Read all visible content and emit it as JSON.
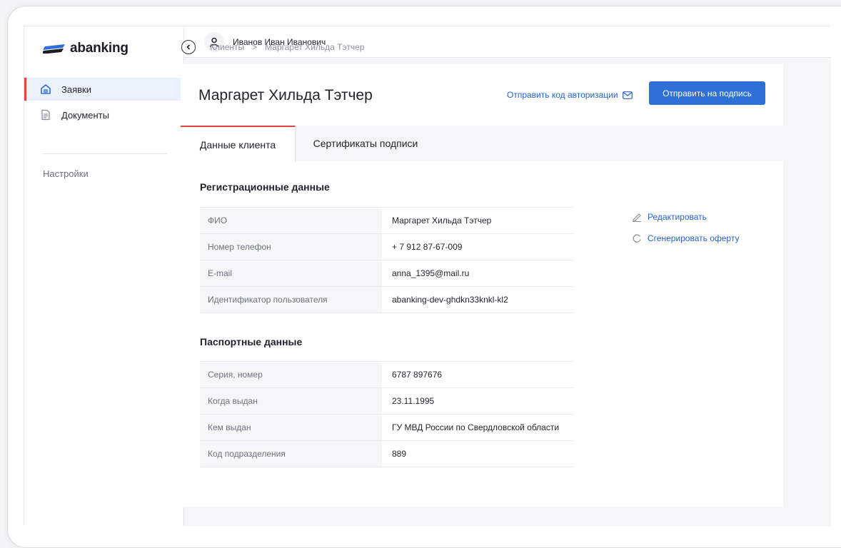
{
  "brand": {
    "name": "abanking",
    "color": "#2f6fd8",
    "accent": "#e0443a"
  },
  "sidebar": {
    "items": [
      {
        "label": "Заявки",
        "icon": "home-icon",
        "active": true
      },
      {
        "label": "Документы",
        "icon": "document-icon",
        "active": false
      }
    ],
    "settings_label": "Настройки"
  },
  "topbar": {
    "user_name": "Иванов Иван Иванович",
    "icon": "user-icon"
  },
  "breadcrumb": {
    "items": [
      "Клиенты",
      "Маргарет Хильда Тэтчер"
    ],
    "separator": ">"
  },
  "page": {
    "title": "Маргарет Хильда Тэтчер",
    "send_code_label": "Отправить код авторизации",
    "send_sign_label": "Отправить на подпись"
  },
  "tabs": [
    {
      "label": "Данные клиента",
      "active": true
    },
    {
      "label": "Сертификаты подписи",
      "active": false
    }
  ],
  "registration": {
    "title": "Регистрационные данные",
    "rows": [
      {
        "key": "ФИО",
        "value": "Маргарет Хильда Тэтчер"
      },
      {
        "key": "Номер телефон",
        "value": "+ 7 912 87-67-009"
      },
      {
        "key": "E-mail",
        "value": "anna_1395@mail.ru"
      },
      {
        "key": "Идентификатор пользователя",
        "value": "abanking-dev-ghdkn33knkl-kl2"
      }
    ]
  },
  "passport": {
    "title": "Паспортные данные",
    "rows": [
      {
        "key": "Серия, номер",
        "value": "6787 897676"
      },
      {
        "key": "Когда выдан",
        "value": "23.11.1995"
      },
      {
        "key": "Кем выдан",
        "value": "ГУ МВД России по Свердловской области"
      },
      {
        "key": "Код подразделения",
        "value": "889"
      }
    ]
  },
  "actions": {
    "edit_label": "Редактировать",
    "generate_label": "Сгенерировать оферту"
  }
}
